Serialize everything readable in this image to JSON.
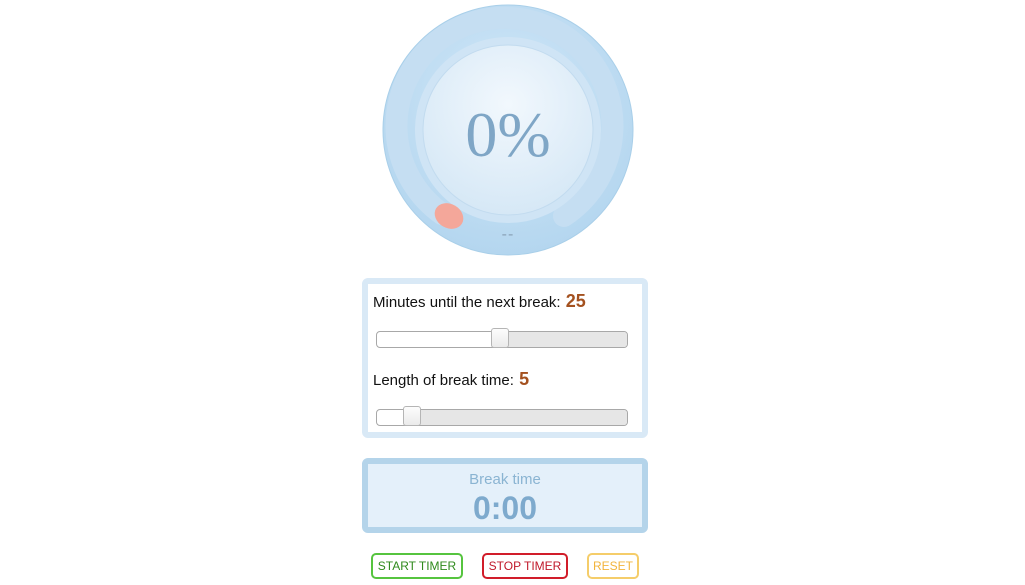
{
  "dial": {
    "percent_text": "0%",
    "progress": 0,
    "status_text": "--",
    "colors": {
      "outer": "#bcdcf2",
      "track": "#d6e7f5",
      "inner": "#e4f0f9",
      "knob": "#f4a79a",
      "text": "#7fa6c6"
    }
  },
  "settings": {
    "work": {
      "label": "Minutes until the next break:",
      "value": "25",
      "slider_fraction": 0.49
    },
    "break": {
      "label": "Length of break time:",
      "value": "5",
      "slider_fraction": 0.14
    }
  },
  "break_panel": {
    "label": "Break time",
    "time": "0:00"
  },
  "buttons": {
    "start": "START TIMER",
    "stop": "STOP TIMER",
    "reset": "RESET"
  }
}
